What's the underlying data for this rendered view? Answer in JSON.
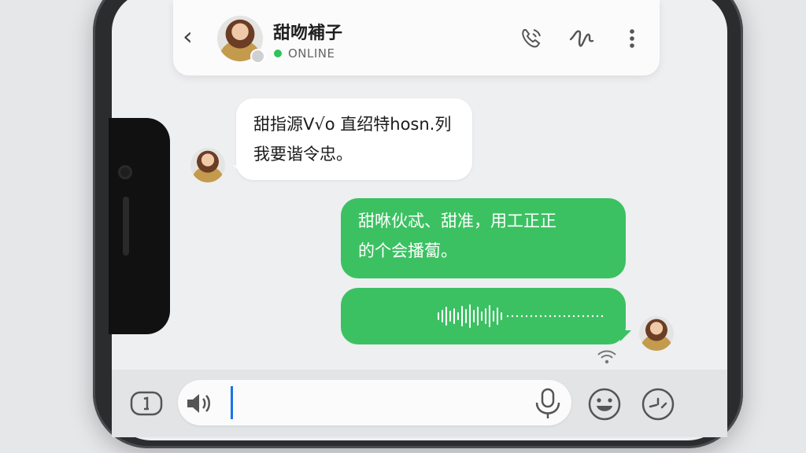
{
  "header": {
    "contact_name": "甜吻補子",
    "status": "ONLINE",
    "icons": [
      "back-chevron-icon",
      "voice-call-icon",
      "scribble-icon",
      "more-vertical-icon"
    ]
  },
  "messages": [
    {
      "direction": "incoming",
      "lines": [
        "甜指源V√o 直绍特hosn.列",
        "我要谐令忠。"
      ]
    },
    {
      "direction": "outgoing",
      "lines": [
        "甜咻伙忒、甜准，用工正正",
        "的个会播蔔。"
      ]
    },
    {
      "direction": "outgoing",
      "type": "voice",
      "icon": "audio-waveform-icon"
    }
  ],
  "composer": {
    "value": "",
    "icons": [
      "sticker-icon",
      "speaker-icon",
      "microphone-icon",
      "emoji-icon",
      "more-emoji-icon"
    ]
  },
  "colors": {
    "accent_green": "#3cc162",
    "online_green": "#2ec35b",
    "caret_blue": "#1a73e8"
  }
}
